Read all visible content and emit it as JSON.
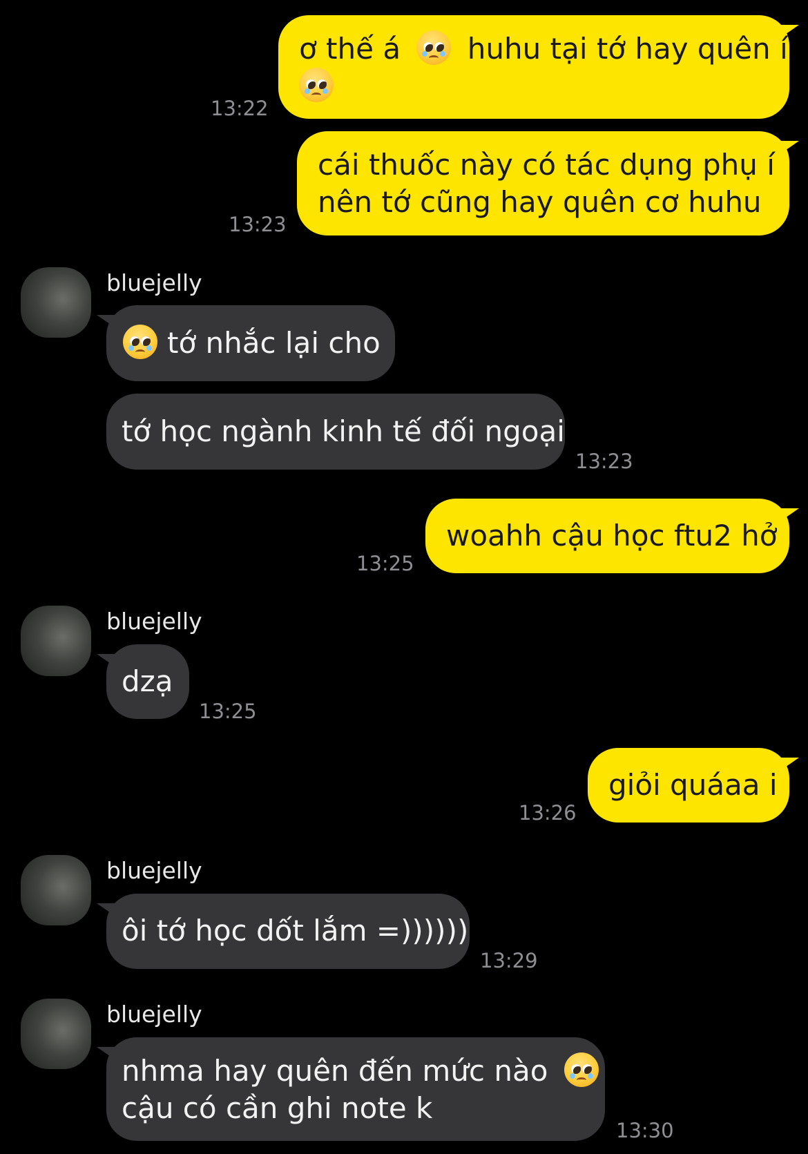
{
  "contact_name": "bluejelly",
  "colors": {
    "outgoing_bubble": "#fee500",
    "incoming_bubble": "#363638",
    "background": "#000000",
    "timestamp": "#8e8e93"
  },
  "messages": [
    {
      "sender": "me",
      "line1_a": "ơ thế á",
      "line1_b": "huhu tại tớ hay quên í",
      "emoji": "pleading-face",
      "time": "13:22"
    },
    {
      "sender": "me",
      "line1": "cái thuốc này có tác dụng phụ í",
      "line2": "nên tớ cũng hay quên cơ huhu",
      "time": "13:23"
    },
    {
      "sender": "bluejelly",
      "text": "tớ nhắc lại cho",
      "emoji": "pleading-face"
    },
    {
      "sender": "bluejelly",
      "text": "tớ học ngành kinh tế đối ngoại",
      "time": "13:23"
    },
    {
      "sender": "me",
      "text": "woahh cậu học ftu2 hở",
      "time": "13:25"
    },
    {
      "sender": "bluejelly",
      "text": "dzạ",
      "time": "13:25"
    },
    {
      "sender": "me",
      "text": "giỏi quáaa i",
      "time": "13:26"
    },
    {
      "sender": "bluejelly",
      "text": "ôi tớ học dốt lắm =))))))",
      "time": "13:29"
    },
    {
      "sender": "bluejelly",
      "line1": "nhma hay quên đến mức nào",
      "line2": "cậu có cần ghi note k",
      "emoji": "pleading-face",
      "time": "13:30"
    }
  ]
}
